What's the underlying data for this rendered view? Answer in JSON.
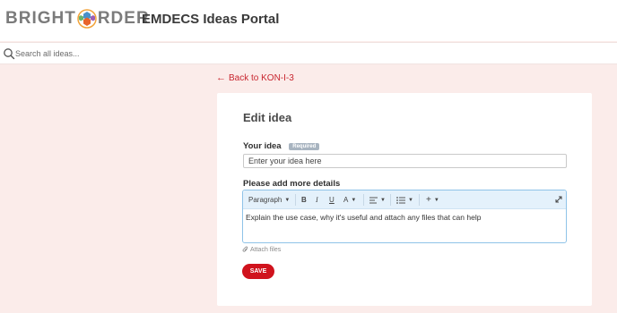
{
  "header": {
    "logo_text_left": "BRIGHT",
    "logo_text_right": "RDER",
    "portal_title": "EMDECS Ideas Portal"
  },
  "search": {
    "placeholder": "Search all ideas..."
  },
  "nav": {
    "back_label": "Back to KON-I-3"
  },
  "form": {
    "title": "Edit idea",
    "idea_label": "Your idea",
    "required_badge": "Required",
    "idea_placeholder": "Enter your idea here",
    "details_label": "Please add more details",
    "editor_placeholder": "Explain the use case, why it's useful and attach any files that can help",
    "attach_label": "Attach files",
    "save_label": "SAVE"
  },
  "toolbar": {
    "paragraph_label": "Paragraph",
    "bold_label": "B",
    "italic_label": "I",
    "underline_label": "U",
    "font_color_label": "A",
    "add_label": "+"
  },
  "colors": {
    "accent": "#d0131d",
    "page_background": "#fbecea",
    "editor_border": "#8fc3e8"
  }
}
